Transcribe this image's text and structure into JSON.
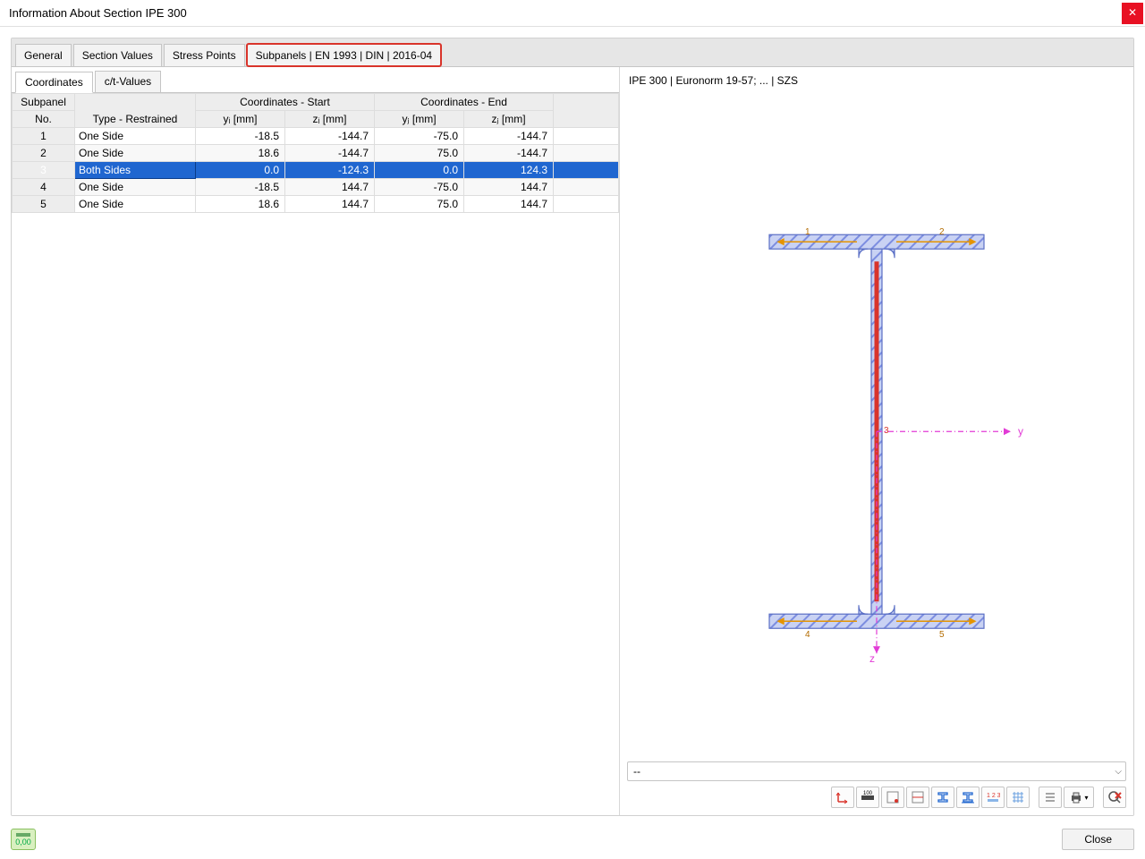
{
  "window": {
    "title": "Information About Section IPE 300"
  },
  "tabs": {
    "items": [
      "General",
      "Section Values",
      "Stress Points",
      "Subpanels | EN 1993 | DIN | 2016-04"
    ],
    "highlighted_index": 3
  },
  "subtabs": {
    "items": [
      "Coordinates",
      "c/t-Values"
    ],
    "active_index": 0
  },
  "table": {
    "headers": {
      "subpanel_top": "Subpanel",
      "subpanel_bot": "No.",
      "type": "Type - Restrained",
      "coords_start": "Coordinates - Start",
      "coords_end": "Coordinates - End",
      "yi": "yᵢ [mm]",
      "zi": "zᵢ [mm]",
      "yj": "yⱼ [mm]",
      "zj": "zⱼ [mm]"
    },
    "rows": [
      {
        "no": "1",
        "type": "One Side",
        "yi": "-18.5",
        "zi": "-144.7",
        "yj": "-75.0",
        "zj": "-144.7"
      },
      {
        "no": "2",
        "type": "One Side",
        "yi": "18.6",
        "zi": "-144.7",
        "yj": "75.0",
        "zj": "-144.7"
      },
      {
        "no": "3",
        "type": "Both Sides",
        "yi": "0.0",
        "zi": "-124.3",
        "yj": "0.0",
        "zj": "124.3",
        "selected": true
      },
      {
        "no": "4",
        "type": "One Side",
        "yi": "-18.5",
        "zi": "144.7",
        "yj": "-75.0",
        "zj": "144.7"
      },
      {
        "no": "5",
        "type": "One Side",
        "yi": "18.6",
        "zi": "144.7",
        "yj": "75.0",
        "zj": "144.7"
      }
    ]
  },
  "viewer": {
    "caption": "IPE 300 | Euronorm 19-57; ... | SZS",
    "axis_y": "y",
    "axis_z": "z",
    "selected_label": "3",
    "flange_labels": [
      "1",
      "2",
      "4",
      "5"
    ]
  },
  "dropdown": {
    "value": "--"
  },
  "toolbar_icons": [
    "axes",
    "ruler",
    "stress-pts",
    "ct",
    "section",
    "section-dim",
    "num",
    "grid",
    "list",
    "print",
    "reset"
  ],
  "footer": {
    "units_label": "0,00",
    "close_label": "Close"
  },
  "colors": {
    "accent_blue": "#1f66d0",
    "highlight_red": "#d9342b",
    "hatch_blue": "#7c8de0",
    "axis_magenta": "#e23bd6"
  }
}
